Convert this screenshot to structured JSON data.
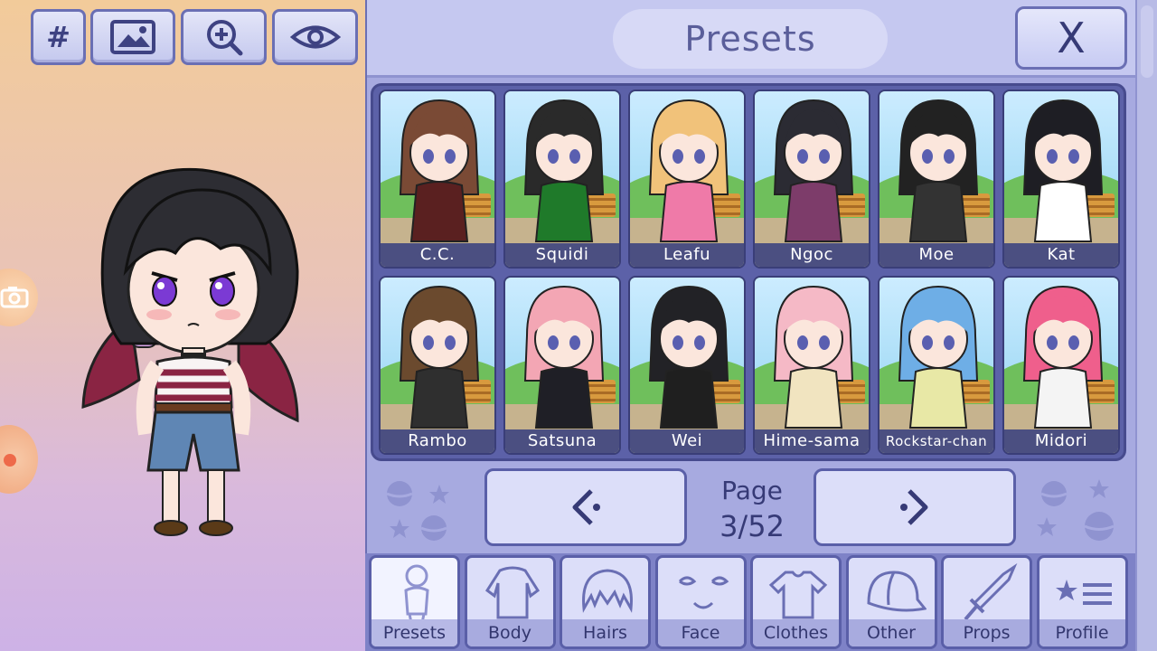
{
  "toolbar": {
    "hash_label": "#",
    "icons": [
      "image-icon",
      "zoom-in-icon",
      "eye-icon"
    ]
  },
  "stage": {
    "side_icons": [
      "camera-icon",
      "record-icon"
    ]
  },
  "header": {
    "title": "Presets",
    "close_label": "X"
  },
  "presets": [
    {
      "name": "C.C.",
      "hair": "#7a4a35",
      "outfit": "#5a2020"
    },
    {
      "name": "Squidi",
      "hair": "#2a2a2a",
      "outfit": "#1f7a2a"
    },
    {
      "name": "Leafu",
      "hair": "#f1c27a",
      "outfit": "#ef7aa8"
    },
    {
      "name": "Ngoc",
      "hair": "#2b2b33",
      "outfit": "#7d3c6a"
    },
    {
      "name": "Moe",
      "hair": "#222222",
      "outfit": "#333333"
    },
    {
      "name": "Kat",
      "hair": "#1e1e24",
      "outfit": "#ffffff"
    },
    {
      "name": "Rambo",
      "hair": "#6b4a2e",
      "outfit": "#2f2f2f"
    },
    {
      "name": "Satsuna",
      "hair": "#f3a6b4",
      "outfit": "#1f1f26"
    },
    {
      "name": "Wei",
      "hair": "#222226",
      "outfit": "#1f1f1f"
    },
    {
      "name": "Hime-sama",
      "hair": "#f5b9c6",
      "outfit": "#f1e4c0"
    },
    {
      "name": "Rockstar-chan",
      "hair": "#6eaee6",
      "outfit": "#e8e8a6"
    },
    {
      "name": "Midori",
      "hair": "#ef5f8c",
      "outfit": "#f4f4f4"
    }
  ],
  "pager": {
    "prev_icon": "chevron-left-icon",
    "next_icon": "chevron-right-icon",
    "page_label": "Page",
    "page_number": "3/52"
  },
  "tabs": [
    {
      "label": "Presets",
      "icon": "person-icon",
      "active": true
    },
    {
      "label": "Body",
      "icon": "body-icon",
      "active": false
    },
    {
      "label": "Hairs",
      "icon": "hair-icon",
      "active": false
    },
    {
      "label": "Face",
      "icon": "face-icon",
      "active": false
    },
    {
      "label": "Clothes",
      "icon": "shirt-icon",
      "active": false
    },
    {
      "label": "Other",
      "icon": "cap-icon",
      "active": false
    },
    {
      "label": "Props",
      "icon": "sword-icon",
      "active": false
    },
    {
      "label": "Profile",
      "icon": "profile-icon",
      "active": false
    }
  ],
  "colors": {
    "panel": "#a7aae0",
    "frame": "#5c61a8",
    "accent": "#363a76"
  }
}
